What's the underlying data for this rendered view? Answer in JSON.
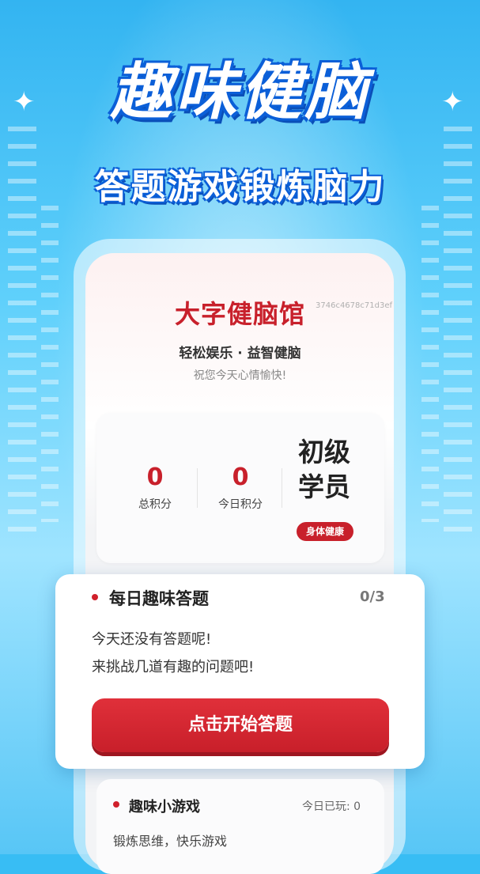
{
  "banner": {
    "title": "趣味健脑",
    "subtitle": "答题游戏锻炼脑力"
  },
  "app": {
    "title": "大字健脑馆",
    "device_id": "3746c4678c71d3ef",
    "tagline": "轻松娱乐 · 益智健脑",
    "greeting": "祝您今天心情愉快!"
  },
  "stats": {
    "total_points": "0",
    "total_points_label": "总积分",
    "today_points": "0",
    "today_points_label": "今日积分",
    "level_line1": "初级",
    "level_line2": "学员",
    "health_badge": "身体健康"
  },
  "daily_quiz": {
    "title": "每日趣味答题",
    "progress": "0/3",
    "message_line1": "今天还没有答题呢!",
    "message_line2": "来挑战几道有趣的问题吧!",
    "start_button": "点击开始答题"
  },
  "mini_games": {
    "title": "趣味小游戏",
    "played_today": "今日已玩: 0",
    "subtitle": "锻炼思维，快乐游戏"
  },
  "colors": {
    "accent_red": "#c8202b",
    "sky_blue": "#38bdf4"
  },
  "icons": [
    "sparkle-icon",
    "bullet-dot-icon"
  ]
}
